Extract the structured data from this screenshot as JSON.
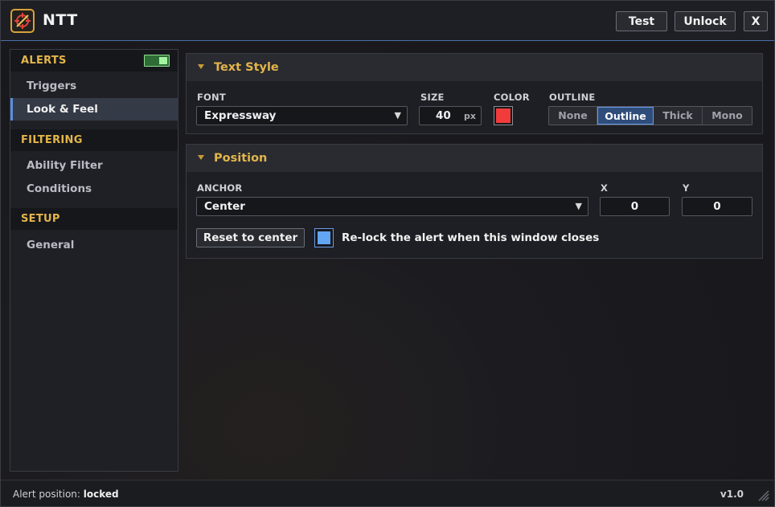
{
  "app": {
    "title": "NTT",
    "icon": "crosshair-logo-icon"
  },
  "titlebar": {
    "test_label": "Test",
    "unlock_label": "Unlock",
    "close_label": "X"
  },
  "sidebar": {
    "alerts_header": "ALERTS",
    "alerts_enabled": true,
    "alerts_items": [
      {
        "label": "Triggers",
        "active": false
      },
      {
        "label": "Look & Feel",
        "active": true
      }
    ],
    "filtering_header": "FILTERING",
    "filtering_items": [
      {
        "label": "Ability Filter"
      },
      {
        "label": "Conditions"
      }
    ],
    "setup_header": "SETUP",
    "setup_items": [
      {
        "label": "General"
      }
    ]
  },
  "text_style": {
    "title": "Text Style",
    "font_label": "FONT",
    "font_value": "Expressway",
    "size_label": "SIZE",
    "size_value": "40",
    "size_unit": "px",
    "color_label": "COLOR",
    "color_value": "#f23b3b",
    "outline_label": "OUTLINE",
    "outline_options": [
      "None",
      "Outline",
      "Thick",
      "Mono"
    ],
    "outline_selected": "Outline"
  },
  "position": {
    "title": "Position",
    "anchor_label": "ANCHOR",
    "anchor_value": "Center",
    "x_label": "X",
    "x_value": "0",
    "y_label": "Y",
    "y_value": "0",
    "reset_label": "Reset to center",
    "relock_label": "Re-lock the alert when this window closes",
    "relock_checked": true
  },
  "status": {
    "prefix": "Alert position:",
    "state": "locked",
    "version": "v1.0"
  },
  "colors": {
    "accent": "#e3b54a",
    "selection": "#5a8fe0",
    "toggle_on": "#a4f3a1"
  }
}
